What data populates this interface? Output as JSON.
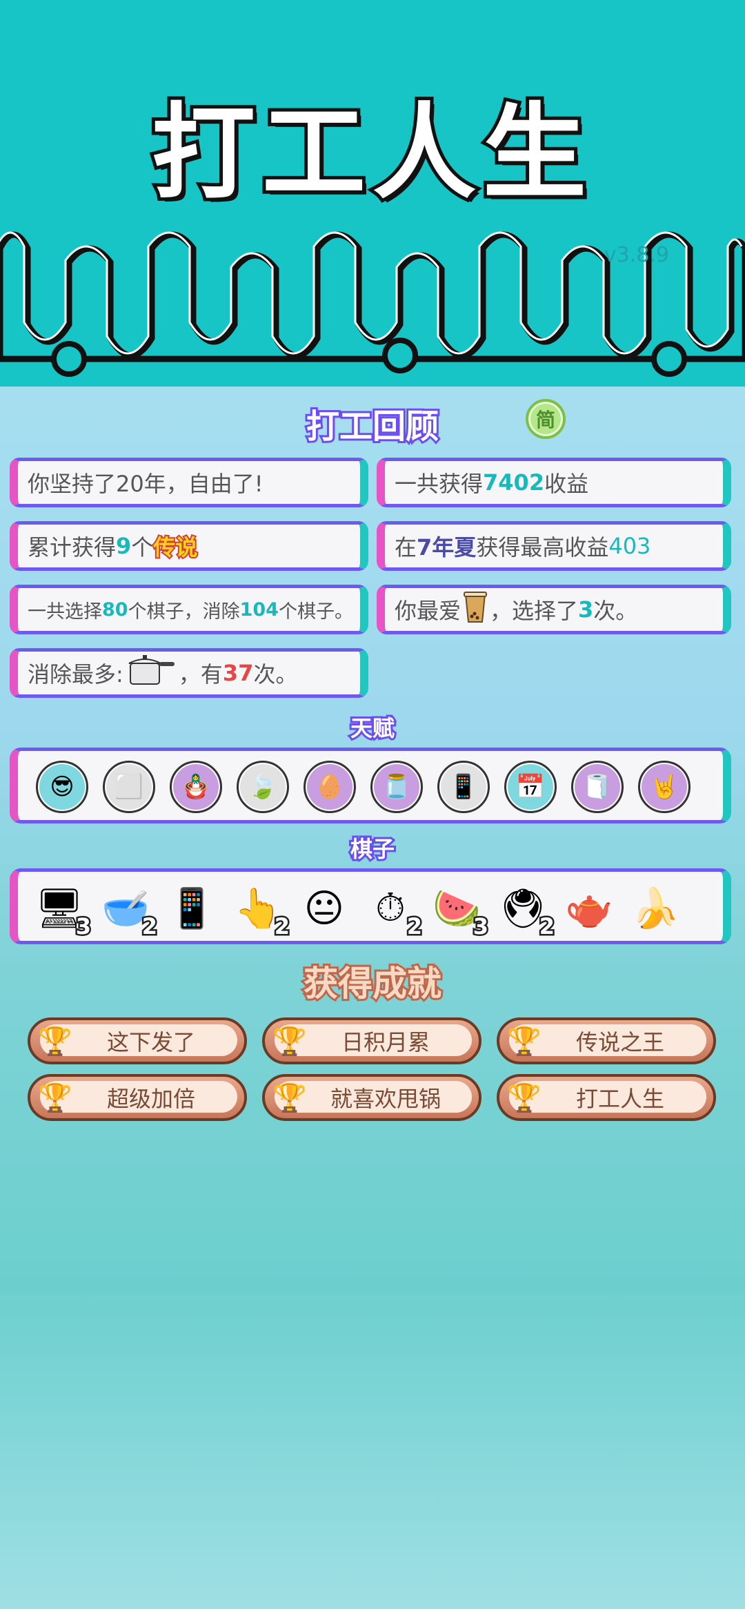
{
  "app": {
    "title": "打工人生",
    "version": "v3.8.9",
    "lang_button": "简"
  },
  "review": {
    "heading": "打工回顾",
    "cards": {
      "persist": {
        "pre": "你坚持了20年，自由了!"
      },
      "total_income": {
        "pre": "一共获得",
        "num": "7402",
        "post": "收益"
      },
      "legend": {
        "pre": "累计获得",
        "num": "9",
        "mid": "个",
        "tag": "传说"
      },
      "max_income": {
        "pre": "在 ",
        "year": "7年",
        "sp": " ",
        "season": "夏",
        "mid": " 获得最高收益",
        "num": "403"
      },
      "choose": {
        "p1": "一共选择",
        "n1": "80",
        "p2": "个棋子，消除",
        "n2": "104",
        "p3": "个棋子。"
      },
      "favorite": {
        "pre": "你最爱",
        "mid": "，选择了",
        "num": "3",
        "post": "次。",
        "icon": "milk-tea-icon"
      },
      "removed": {
        "pre": "消除最多:",
        "mid": "，有",
        "num": "37",
        "post": "次。",
        "icon": "pressure-cooker-icon"
      }
    }
  },
  "talents": {
    "heading": "天赋",
    "items": [
      {
        "icon": "sunglasses-face-icon",
        "glyph": "😎",
        "bg": "#7fd8e0"
      },
      {
        "icon": "tofu-icon",
        "glyph": "⬜",
        "bg": "#e2e2e2"
      },
      {
        "icon": "dolls-icon",
        "glyph": "🪆",
        "bg": "#c89ee0"
      },
      {
        "icon": "leaf-icon",
        "glyph": "🍃",
        "bg": "#e2e2e2"
      },
      {
        "icon": "egg-icon",
        "glyph": "🥚",
        "bg": "#c89ee0"
      },
      {
        "icon": "jar-icon",
        "glyph": "🫙",
        "bg": "#c89ee0"
      },
      {
        "icon": "phone-app-icon",
        "glyph": "📱",
        "bg": "#e2e2e2"
      },
      {
        "icon": "calendar-icon",
        "glyph": "📅",
        "bg": "#7fd8e0"
      },
      {
        "icon": "tissue-box-icon",
        "glyph": "🧻",
        "bg": "#c89ee0"
      },
      {
        "icon": "rock-hand-icon",
        "glyph": "🤘",
        "bg": "#c89ee0"
      }
    ]
  },
  "pieces": {
    "heading": "棋子",
    "items": [
      {
        "icon": "graphics-card-icon",
        "glyph": "🖥",
        "count": "3"
      },
      {
        "icon": "bowl-icon",
        "glyph": "🥣",
        "count": "2"
      },
      {
        "icon": "phone-icon",
        "glyph": "📱",
        "count": ""
      },
      {
        "icon": "pointing-hand-icon",
        "glyph": "👆",
        "count": "2"
      },
      {
        "icon": "face-icon",
        "glyph": "😐",
        "count": ""
      },
      {
        "icon": "stopwatch-icon",
        "glyph": "⏱",
        "count": "2"
      },
      {
        "icon": "watermelon-icon",
        "glyph": "🍉",
        "count": "3"
      },
      {
        "icon": "pc-tower-icon",
        "glyph": "🖲",
        "count": "2"
      },
      {
        "icon": "teapot-icon",
        "glyph": "🫖",
        "count": ""
      },
      {
        "icon": "banana-icon",
        "glyph": "🍌",
        "count": ""
      }
    ]
  },
  "achievements": {
    "heading": "获得成就",
    "items": [
      "这下发了",
      "日积月累",
      "传说之王",
      "超级加倍",
      "就喜欢甩锅",
      "打工人生"
    ]
  }
}
